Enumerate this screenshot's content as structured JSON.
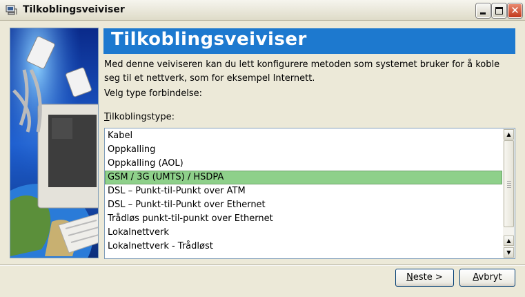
{
  "window": {
    "title": "Tilkoblingsveiviser"
  },
  "header": {
    "title": "Tilkoblingsveiviser"
  },
  "intro_text": "Med denne veiviseren kan du lett konfigurere metoden som systemet bruker for å koble seg til et nettverk, som for eksempel Internett.",
  "prompt": "Velg type forbindelse:",
  "list": {
    "label_accel": "T",
    "label_rest": "ilkoblingstype:",
    "items": [
      "Kabel",
      "Oppkalling",
      "Oppkalling (AOL)",
      "GSM / 3G (UMTS) / HSDPA",
      "DSL – Punkt-til-Punkt over ATM",
      "DSL – Punkt-til-Punkt over Ethernet",
      "Trådløs punkt-til-punkt over Ethernet",
      "Lokalnettverk",
      "Lokalnettverk - Trådløst"
    ],
    "selected_index": 3
  },
  "buttons": {
    "next_accel": "N",
    "next_rest": "este >",
    "cancel_accel": "A",
    "cancel_rest": "vbryt"
  },
  "icons": {
    "window_controls": [
      "minimize-icon",
      "maximize-icon",
      "close-icon"
    ],
    "scroll": [
      "scroll-up-icon",
      "scroll-down-icon"
    ]
  },
  "colors": {
    "header": "#1d79cf",
    "selection": "#8ed08a",
    "close": "#c2381b"
  }
}
